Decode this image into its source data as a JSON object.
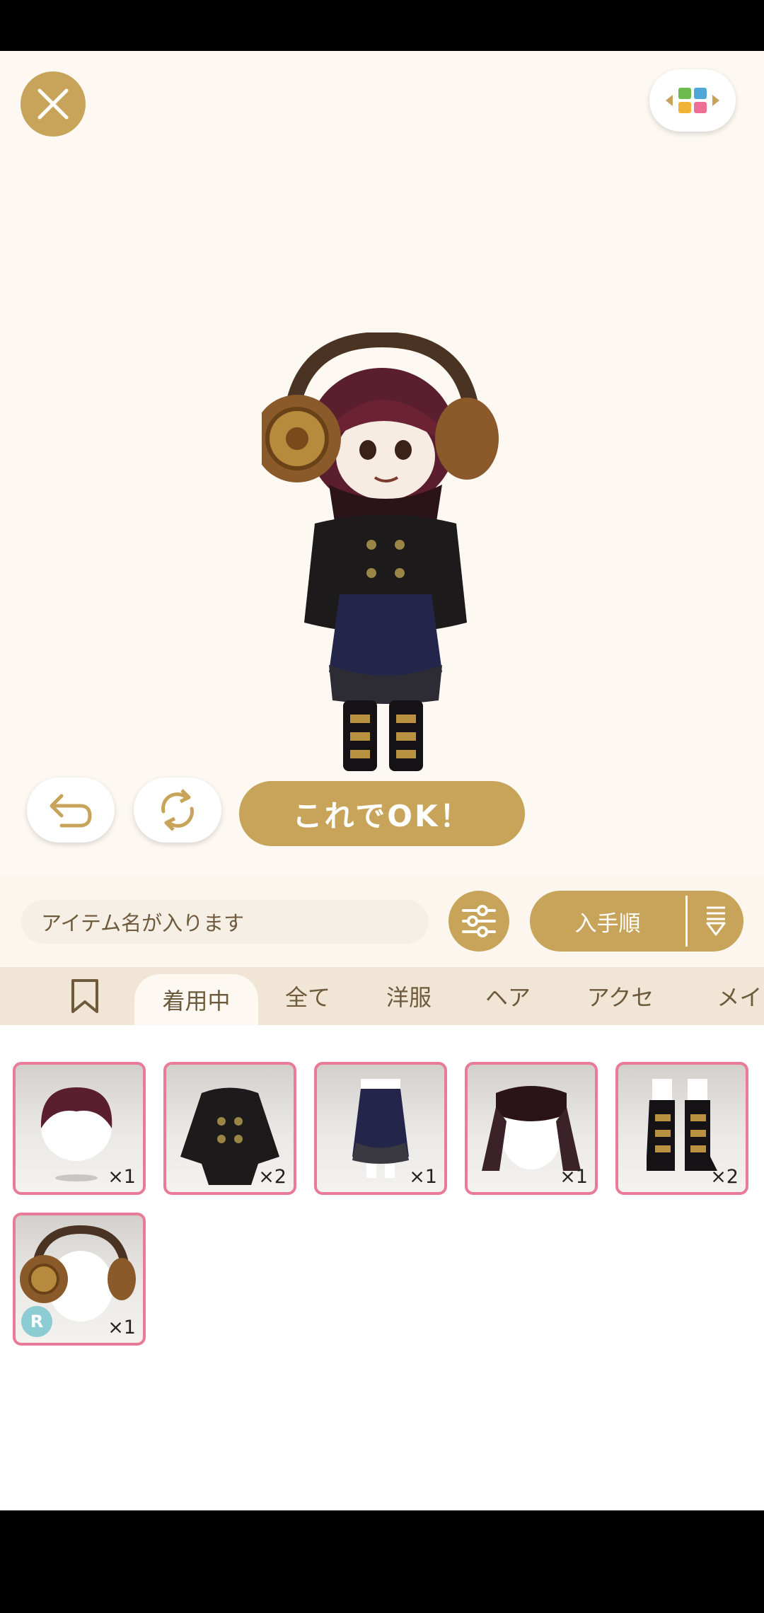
{
  "ok_button": {
    "label": "これでOK！"
  },
  "search": {
    "placeholder": "アイテム名が入ります"
  },
  "sort": {
    "label": "入手順"
  },
  "tabs": [
    {
      "label": "着用中",
      "active": true
    },
    {
      "label": "全て"
    },
    {
      "label": "洋服"
    },
    {
      "label": "ヘア"
    },
    {
      "label": "アクセ"
    },
    {
      "label": "メイク"
    }
  ],
  "items": [
    {
      "icon": "hair-item",
      "qty": "×1"
    },
    {
      "icon": "coat-item",
      "qty": "×2"
    },
    {
      "icon": "skirt-item",
      "qty": "×1"
    },
    {
      "icon": "scarf-item",
      "qty": "×1"
    },
    {
      "icon": "boots-item",
      "qty": "×2"
    },
    {
      "icon": "headphones-item",
      "qty": "×1",
      "rarity": "R"
    }
  ],
  "colors": {
    "accent": "#c7a45a",
    "background": "#fdf8f2",
    "item_border": "#e97b98",
    "tab_bar": "#f1e6d5"
  }
}
